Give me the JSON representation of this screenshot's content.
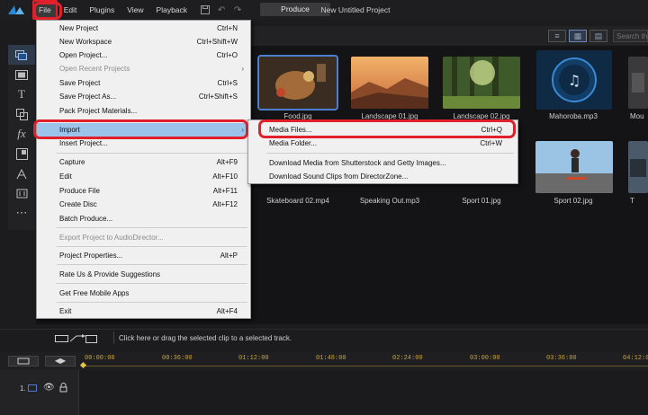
{
  "menubar": {
    "items": [
      "File",
      "Edit",
      "Plugins",
      "View",
      "Playback"
    ],
    "produce_label": "Produce",
    "project_title": "New Untitled Project"
  },
  "library": {
    "search_placeholder": "Search the",
    "thumbnails": [
      {
        "label": "Food.jpg",
        "kind": "food"
      },
      {
        "label": "Landscape 01.jpg",
        "kind": "canyon"
      },
      {
        "label": "Landscape 02.jpg",
        "kind": "forest"
      },
      {
        "label": "Mahoroba.mp3",
        "kind": "audio"
      },
      {
        "label": "Mou",
        "kind": "partial"
      },
      {
        "label": "Skateboard 02.mp4",
        "kind": "hidden"
      },
      {
        "label": "Speaking Out.mp3",
        "kind": "hidden"
      },
      {
        "label": "Sport 01.jpg",
        "kind": "hidden"
      },
      {
        "label": "Sport 02.jpg",
        "kind": "skate"
      },
      {
        "label": "T",
        "kind": "partial2"
      }
    ]
  },
  "file_menu": {
    "items": [
      {
        "label": "New Project",
        "shortcut": "Ctrl+N"
      },
      {
        "label": "New Workspace",
        "shortcut": "Ctrl+Shift+W"
      },
      {
        "label": "Open Project...",
        "shortcut": "Ctrl+O"
      },
      {
        "label": "Open Recent Projects",
        "shortcut": "",
        "disabled": true,
        "submenu": true
      },
      {
        "label": "Save Project",
        "shortcut": "Ctrl+S"
      },
      {
        "label": "Save Project As...",
        "shortcut": "Ctrl+Shift+S"
      },
      {
        "label": "Pack Project Materials...",
        "shortcut": ""
      },
      {
        "label": "Import",
        "shortcut": "",
        "submenu": true,
        "highlighted": true
      },
      {
        "label": "Insert Project...",
        "shortcut": ""
      },
      {
        "label": "Capture",
        "shortcut": "Alt+F9"
      },
      {
        "label": "Edit",
        "shortcut": "Alt+F10"
      },
      {
        "label": "Produce File",
        "shortcut": "Alt+F11"
      },
      {
        "label": "Create Disc",
        "shortcut": "Alt+F12"
      },
      {
        "label": "Batch Produce...",
        "shortcut": ""
      },
      {
        "label": "Export Project to AudioDirector...",
        "shortcut": "",
        "disabled": true
      },
      {
        "label": "Project Properties...",
        "shortcut": "Alt+P"
      },
      {
        "label": "Rate Us & Provide Suggestions",
        "shortcut": ""
      },
      {
        "label": "Get Free Mobile Apps",
        "shortcut": ""
      },
      {
        "label": "Exit",
        "shortcut": "Alt+F4"
      }
    ]
  },
  "import_submenu": {
    "items": [
      {
        "label": "Media Files...",
        "shortcut": "Ctrl+Q"
      },
      {
        "label": "Media Folder...",
        "shortcut": "Ctrl+W"
      },
      {
        "label": "Download Media from Shutterstock and Getty Images...",
        "shortcut": ""
      },
      {
        "label": "Download Sound Clips from DirectorZone...",
        "shortcut": ""
      }
    ]
  },
  "timeline": {
    "hint": "Click here or drag the selected clip to a selected track.",
    "ticks": [
      "00:00:00",
      "00:36:00",
      "01:12:00",
      "01:48:00",
      "02:24:00",
      "03:00:00",
      "03:36:00",
      "04:12:00"
    ],
    "track_number": "1."
  },
  "colors": {
    "accent_red": "#e0202a",
    "menu_highlight": "#9cc3ea",
    "selection_blue": "#4d7fd0",
    "ruler_gold": "#c9a23a"
  }
}
